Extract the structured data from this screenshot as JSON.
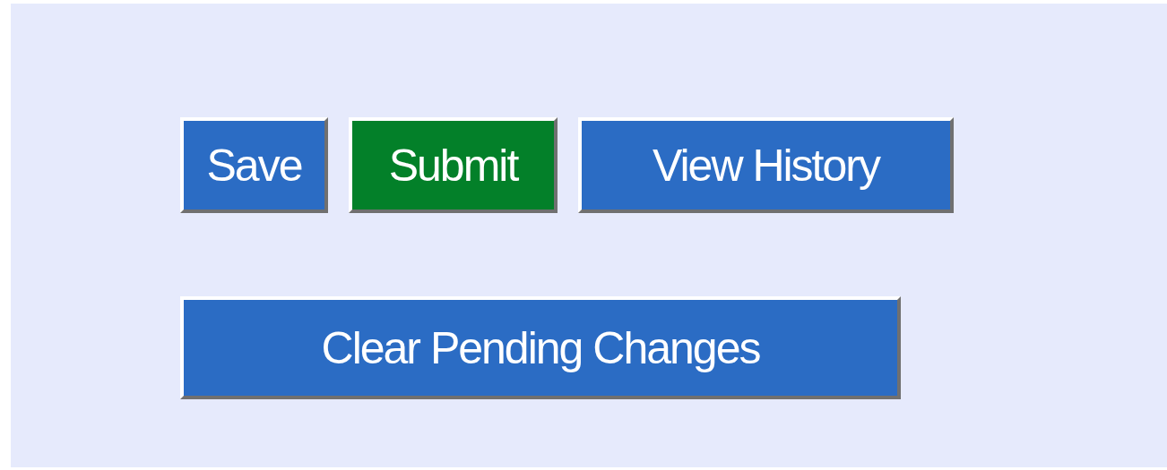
{
  "button_rows": [
    [
      {
        "label": "Save",
        "kind": "default"
      },
      {
        "label": "Submit",
        "kind": "success"
      },
      {
        "label": "View History",
        "kind": "default"
      }
    ],
    [
      {
        "label": "Clear Pending Changes",
        "kind": "default"
      }
    ]
  ]
}
